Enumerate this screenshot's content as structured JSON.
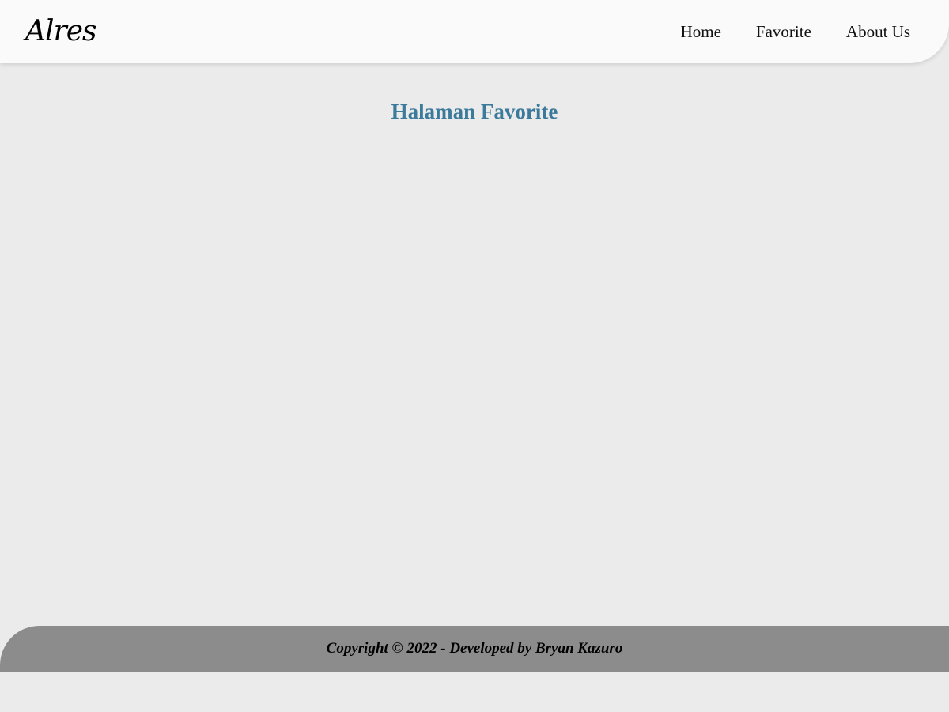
{
  "header": {
    "brand": "Alres",
    "nav": [
      {
        "label": "Home"
      },
      {
        "label": "Favorite"
      },
      {
        "label": "About Us"
      }
    ]
  },
  "main": {
    "title": "Halaman Favorite"
  },
  "footer": {
    "copyright": "Copyright © 2022 - Developed by Bryan Kazuro"
  },
  "colors": {
    "header_bg": "#fafafa",
    "page_bg": "#ebebeb",
    "title": "#3c7a9b",
    "footer_bg": "#8b8c8b"
  }
}
